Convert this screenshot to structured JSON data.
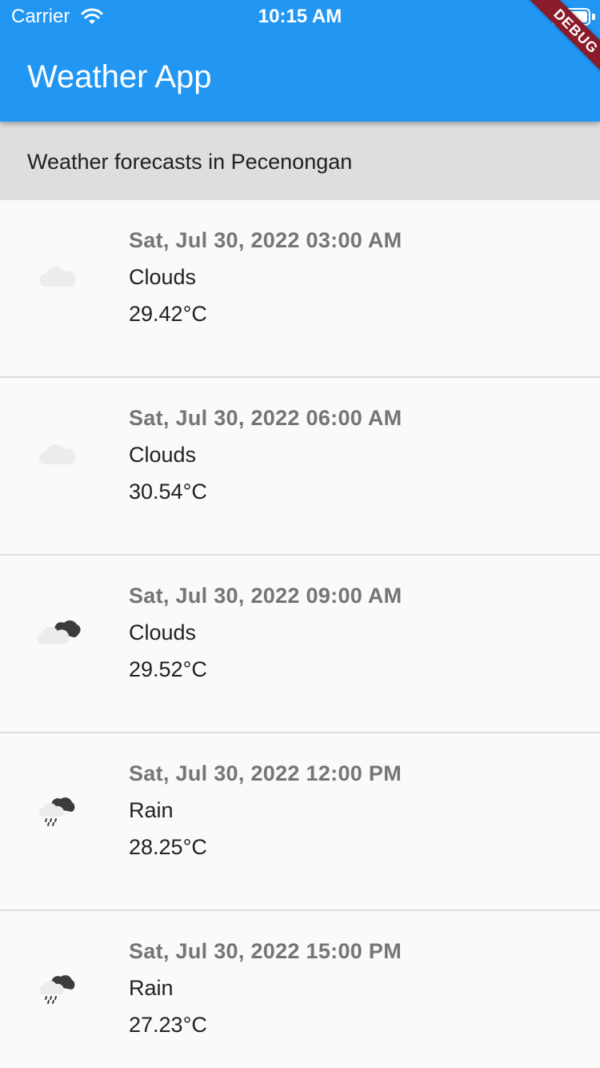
{
  "status_bar": {
    "carrier": "Carrier",
    "time": "10:15 AM",
    "wifi_icon": "wifi-icon",
    "battery_icon": "battery-icon"
  },
  "app_bar": {
    "title": "Weather App",
    "color": "#2196f3",
    "debug_label": "DEBUG"
  },
  "subheader": {
    "text": "Weather forecasts in Pecenongan"
  },
  "forecasts": [
    {
      "datetime": "Sat, Jul 30, 2022 03:00 AM",
      "condition": "Clouds",
      "temperature": "29.42°C",
      "icon": "cloud-light-icon"
    },
    {
      "datetime": "Sat, Jul 30, 2022 06:00 AM",
      "condition": "Clouds",
      "temperature": "30.54°C",
      "icon": "cloud-light-icon"
    },
    {
      "datetime": "Sat, Jul 30, 2022 09:00 AM",
      "condition": "Clouds",
      "temperature": "29.52°C",
      "icon": "broken-clouds-icon"
    },
    {
      "datetime": "Sat, Jul 30, 2022 12:00 PM",
      "condition": "Rain",
      "temperature": "28.25°C",
      "icon": "rain-cloud-icon"
    },
    {
      "datetime": "Sat, Jul 30, 2022 15:00 PM",
      "condition": "Rain",
      "temperature": "27.23°C",
      "icon": "rain-cloud-icon"
    }
  ]
}
